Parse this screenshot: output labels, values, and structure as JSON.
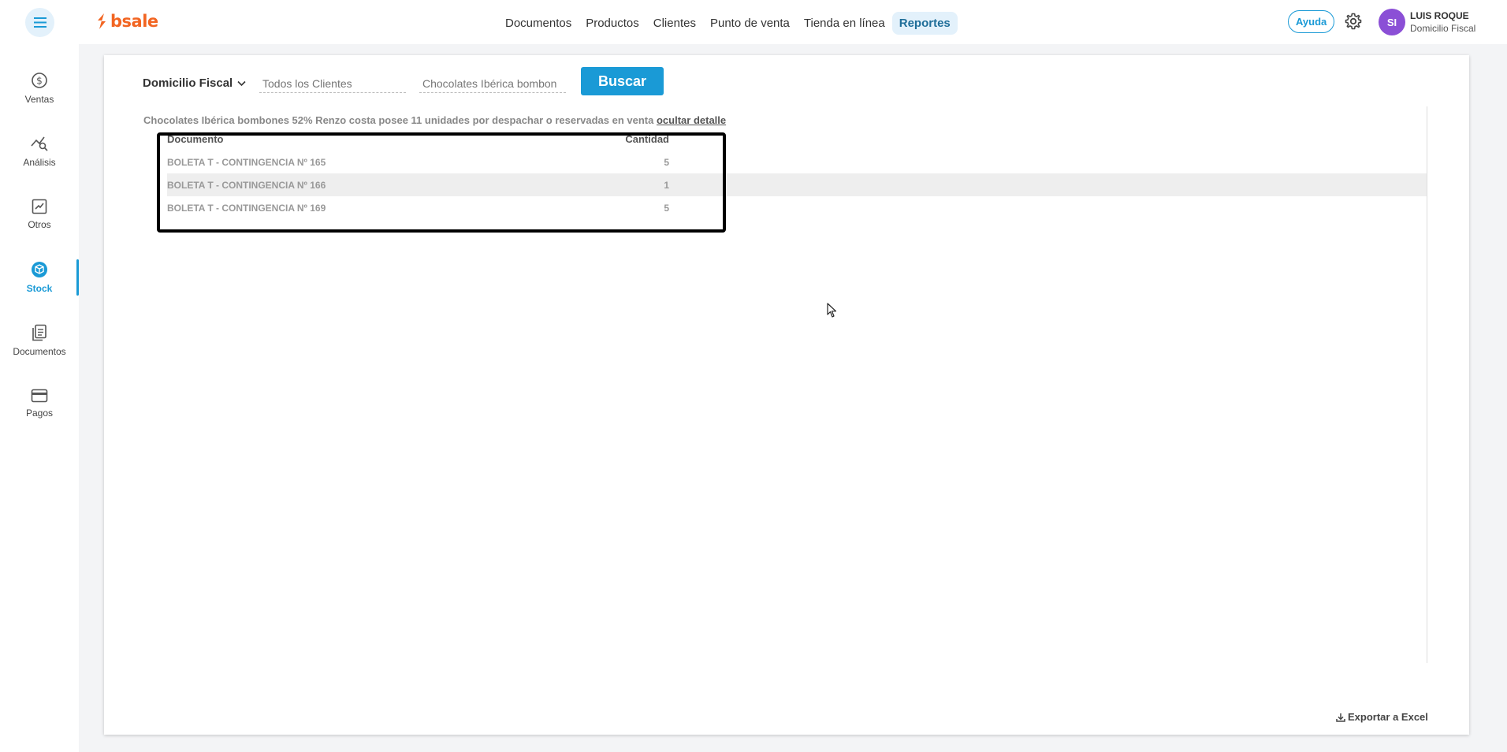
{
  "header": {
    "logo_text": "bsale",
    "nav": [
      {
        "label": "Documentos"
      },
      {
        "label": "Productos"
      },
      {
        "label": "Clientes"
      },
      {
        "label": "Punto de venta"
      },
      {
        "label": "Tienda en línea"
      },
      {
        "label": "Reportes",
        "active": true
      }
    ],
    "help_label": "Ayuda",
    "avatar_initials": "SI",
    "user_name": "LUIS ROQUE",
    "user_branch": "Domicilio Fiscal"
  },
  "sidebar": {
    "items": [
      {
        "label": "Ventas",
        "icon": "dollar-circle-icon"
      },
      {
        "label": "Análisis",
        "icon": "analysis-chart-icon"
      },
      {
        "label": "Otros",
        "icon": "trend-chart-icon"
      },
      {
        "label": "Stock",
        "icon": "box-icon",
        "active": true
      },
      {
        "label": "Documentos",
        "icon": "documents-icon"
      },
      {
        "label": "Pagos",
        "icon": "card-icon"
      }
    ]
  },
  "filters": {
    "branch": "Domicilio Fiscal",
    "client_placeholder": "Todos los Clientes",
    "product_value": "Chocolates Ibérica bombon",
    "search_label": "Buscar"
  },
  "summary": {
    "text": "Chocolates Ibérica bombones 52% Renzo costa posee 11 unidades por despachar o reservadas en venta",
    "hide_link": "ocultar detalle"
  },
  "detail_table": {
    "columns": [
      "Documento",
      "Cantidad"
    ],
    "rows": [
      {
        "document": "BOLETA T - CONTINGENCIA Nº 165",
        "quantity": "5"
      },
      {
        "document": "BOLETA T - CONTINGENCIA Nº 166",
        "quantity": "1"
      },
      {
        "document": "BOLETA T - CONTINGENCIA Nº 169",
        "quantity": "5"
      }
    ]
  },
  "export_label": "Exportar a Excel",
  "colors": {
    "accent": "#1a9ad6",
    "brand": "#f26522",
    "avatar": "#8b4fd6"
  }
}
